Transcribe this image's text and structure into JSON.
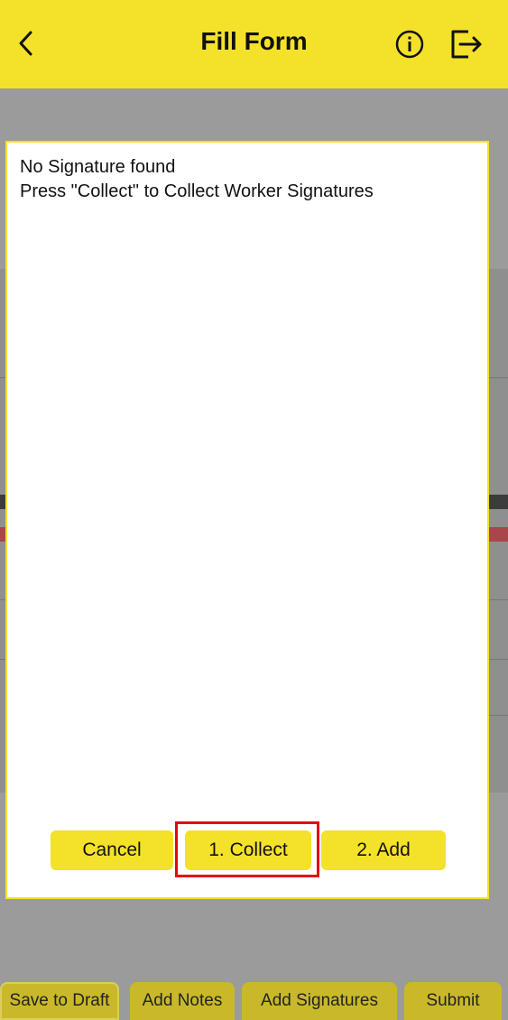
{
  "header": {
    "title": "Fill Form",
    "background": "#f4e12a",
    "icons": [
      "chevron-left-icon",
      "info-icon",
      "logout-icon"
    ]
  },
  "modal": {
    "message_line1": "No Signature found",
    "message_line2": "Press \"Collect\" to Collect Worker Signatures",
    "buttons": {
      "cancel": "Cancel",
      "collect": "1. Collect",
      "add": "2. Add"
    },
    "highlight_color": "#e30613"
  },
  "bottom_bar": {
    "save_draft": "Save to Draft",
    "add_notes": "Add Notes",
    "add_signatures": "Add Signatures",
    "submit": "Submit"
  }
}
